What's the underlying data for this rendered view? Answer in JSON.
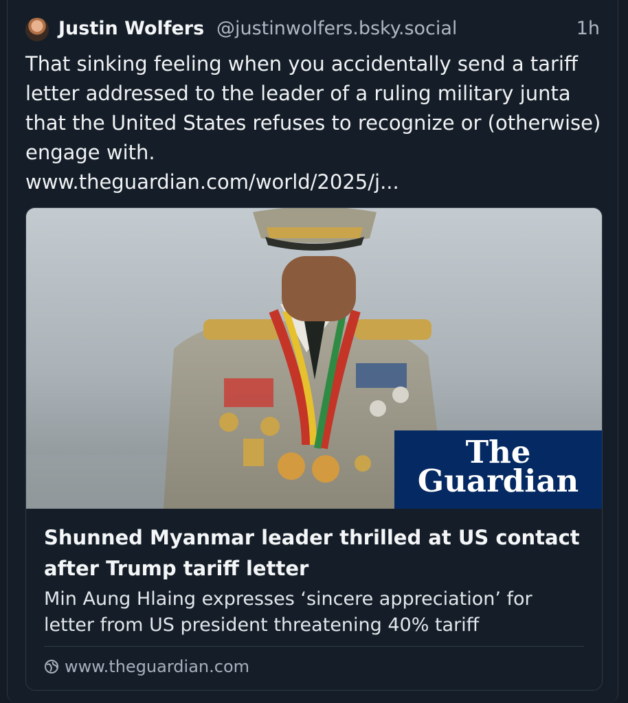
{
  "post": {
    "author_name": "Justin Wolfers",
    "author_handle": "@justinwolfers.bsky.social",
    "timestamp": "1h",
    "text": "That sinking feeling when you accidentally send a tariff letter addressed to the leader of a ruling military junta that the United States refuses to recognize or (otherwise) engage with.",
    "link_text": "www.theguardian.com/world/2025/j..."
  },
  "card": {
    "logo_line1": "The",
    "logo_line2": "Guardian",
    "title": "Shunned Myanmar leader thrilled at US contact after Trump tariff letter",
    "description": "Min Aung Hlaing expresses ‘sincere appreciation’ for letter from US president threatening 40% tariff",
    "domain": "www.theguardian.com"
  },
  "colors": {
    "background": "#141b24",
    "guardian_blue": "#052962"
  },
  "icons": {
    "avatar": "profile-photo",
    "domain_icon": "globe-icon"
  }
}
